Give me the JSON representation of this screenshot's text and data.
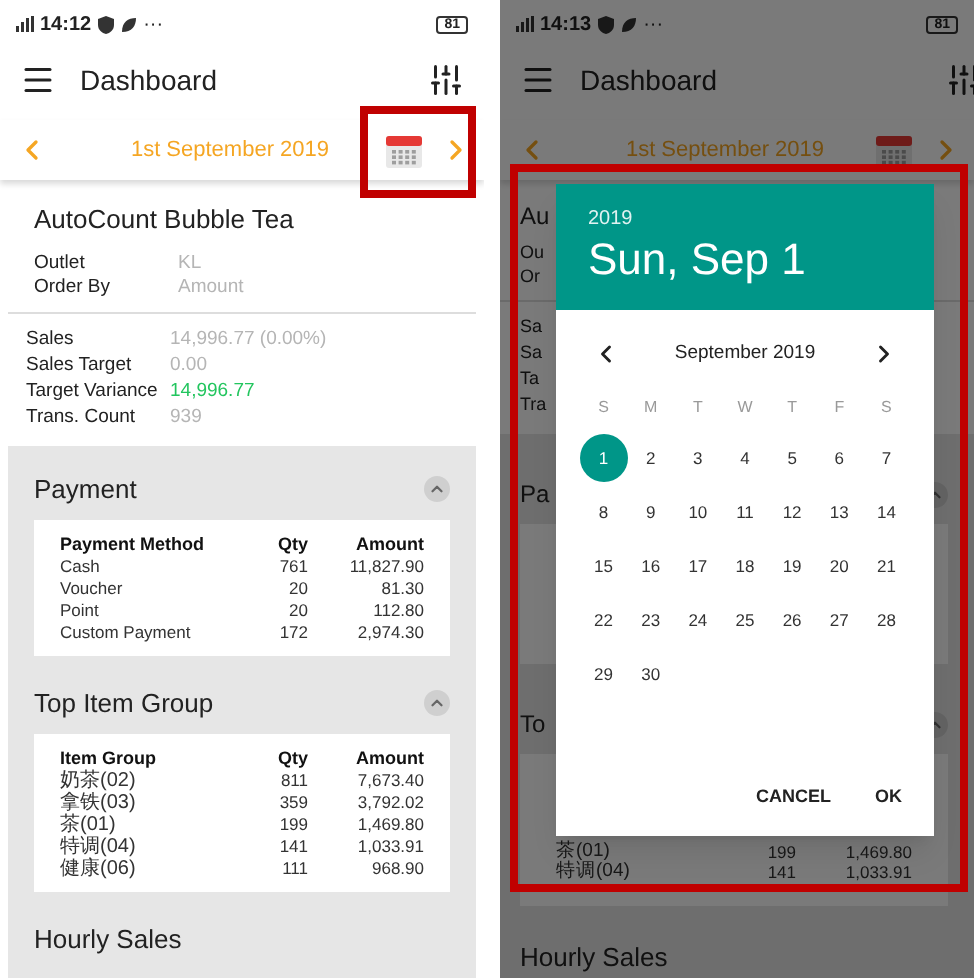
{
  "left_screen": {
    "status_bar": {
      "time": "14:12",
      "dots": "···",
      "battery": "81"
    },
    "app_bar": {
      "title": "Dashboard"
    },
    "date_nav": {
      "date": "1st September 2019"
    },
    "store": {
      "name": "AutoCount Bubble Tea",
      "fields": [
        {
          "label": "Outlet",
          "value": "KL"
        },
        {
          "label": "Order By",
          "value": "Amount"
        }
      ]
    },
    "metrics": [
      {
        "label": "Sales",
        "value": "14,996.77 (0.00%)",
        "kind": "muted"
      },
      {
        "label": "Sales Target",
        "value": "0.00",
        "kind": "muted"
      },
      {
        "label": "Target Variance",
        "value": "14,996.77",
        "kind": "positive"
      },
      {
        "label": "Trans. Count",
        "value": "939",
        "kind": "muted"
      }
    ],
    "sections": [
      {
        "title": "Payment",
        "expanded": true,
        "columns": [
          "Payment Method",
          "Qty",
          "Amount"
        ],
        "rows": [
          [
            "Cash",
            "761",
            "11,827.90"
          ],
          [
            "Voucher",
            "20",
            "81.30"
          ],
          [
            "Point",
            "20",
            "112.80"
          ],
          [
            "Custom Payment",
            "172",
            "2,974.30"
          ]
        ]
      },
      {
        "title": "Top Item Group",
        "expanded": true,
        "columns": [
          "Item Group",
          "Qty",
          "Amount"
        ],
        "rows": [
          [
            "奶茶(02)",
            "811",
            "7,673.40"
          ],
          [
            "拿铁(03)",
            "359",
            "3,792.02"
          ],
          [
            "茶(01)",
            "199",
            "1,469.80"
          ],
          [
            "特调(04)",
            "141",
            "1,033.91"
          ],
          [
            "健康(06)",
            "111",
            "968.90"
          ]
        ]
      },
      {
        "title": "Hourly Sales"
      }
    ]
  },
  "right_screen": {
    "status_bar": {
      "time": "14:13",
      "dots": "···",
      "battery": "81"
    },
    "app_bar": {
      "title": "Dashboard"
    },
    "date_nav": {
      "date": "1st September 2019"
    },
    "store_fragments": [
      "Au",
      "Ou",
      "Or"
    ],
    "metric_fragments": [
      "Sa",
      "Sa",
      "Ta",
      "Tra"
    ],
    "section_fragments": [
      {
        "title": "Pa",
        "expanded": true
      },
      {
        "title": "To",
        "expanded": true
      }
    ],
    "visible_rows": [
      [
        "茶(01)",
        "199",
        "1,469.80"
      ],
      [
        "特调(04)",
        "141",
        "1,033.91"
      ]
    ],
    "bottom_title": "Hourly Sales",
    "date_picker": {
      "year": "2019",
      "date": "Sun, Sep 1",
      "month": "September 2019",
      "weekdays": [
        "S",
        "M",
        "T",
        "W",
        "T",
        "F",
        "S"
      ],
      "days": [
        {
          "label": "1",
          "selected": true
        },
        {
          "label": "2",
          "selected": false
        },
        {
          "label": "3",
          "selected": false
        },
        {
          "label": "4",
          "selected": false
        },
        {
          "label": "5",
          "selected": false
        },
        {
          "label": "6",
          "selected": false
        },
        {
          "label": "7",
          "selected": false
        },
        {
          "label": "8",
          "selected": false
        },
        {
          "label": "9",
          "selected": false
        },
        {
          "label": "10",
          "selected": false
        },
        {
          "label": "11",
          "selected": false
        },
        {
          "label": "12",
          "selected": false
        },
        {
          "label": "13",
          "selected": false
        },
        {
          "label": "14",
          "selected": false
        },
        {
          "label": "15",
          "selected": false
        },
        {
          "label": "16",
          "selected": false
        },
        {
          "label": "17",
          "selected": false
        },
        {
          "label": "18",
          "selected": false
        },
        {
          "label": "19",
          "selected": false
        },
        {
          "label": "20",
          "selected": false
        },
        {
          "label": "21",
          "selected": false
        },
        {
          "label": "22",
          "selected": false
        },
        {
          "label": "23",
          "selected": false
        },
        {
          "label": "24",
          "selected": false
        },
        {
          "label": "25",
          "selected": false
        },
        {
          "label": "26",
          "selected": false
        },
        {
          "label": "27",
          "selected": false
        },
        {
          "label": "28",
          "selected": false
        },
        {
          "label": "29",
          "selected": false
        },
        {
          "label": "30",
          "selected": false
        }
      ],
      "buttons": [
        "CANCEL",
        "OK"
      ]
    }
  }
}
